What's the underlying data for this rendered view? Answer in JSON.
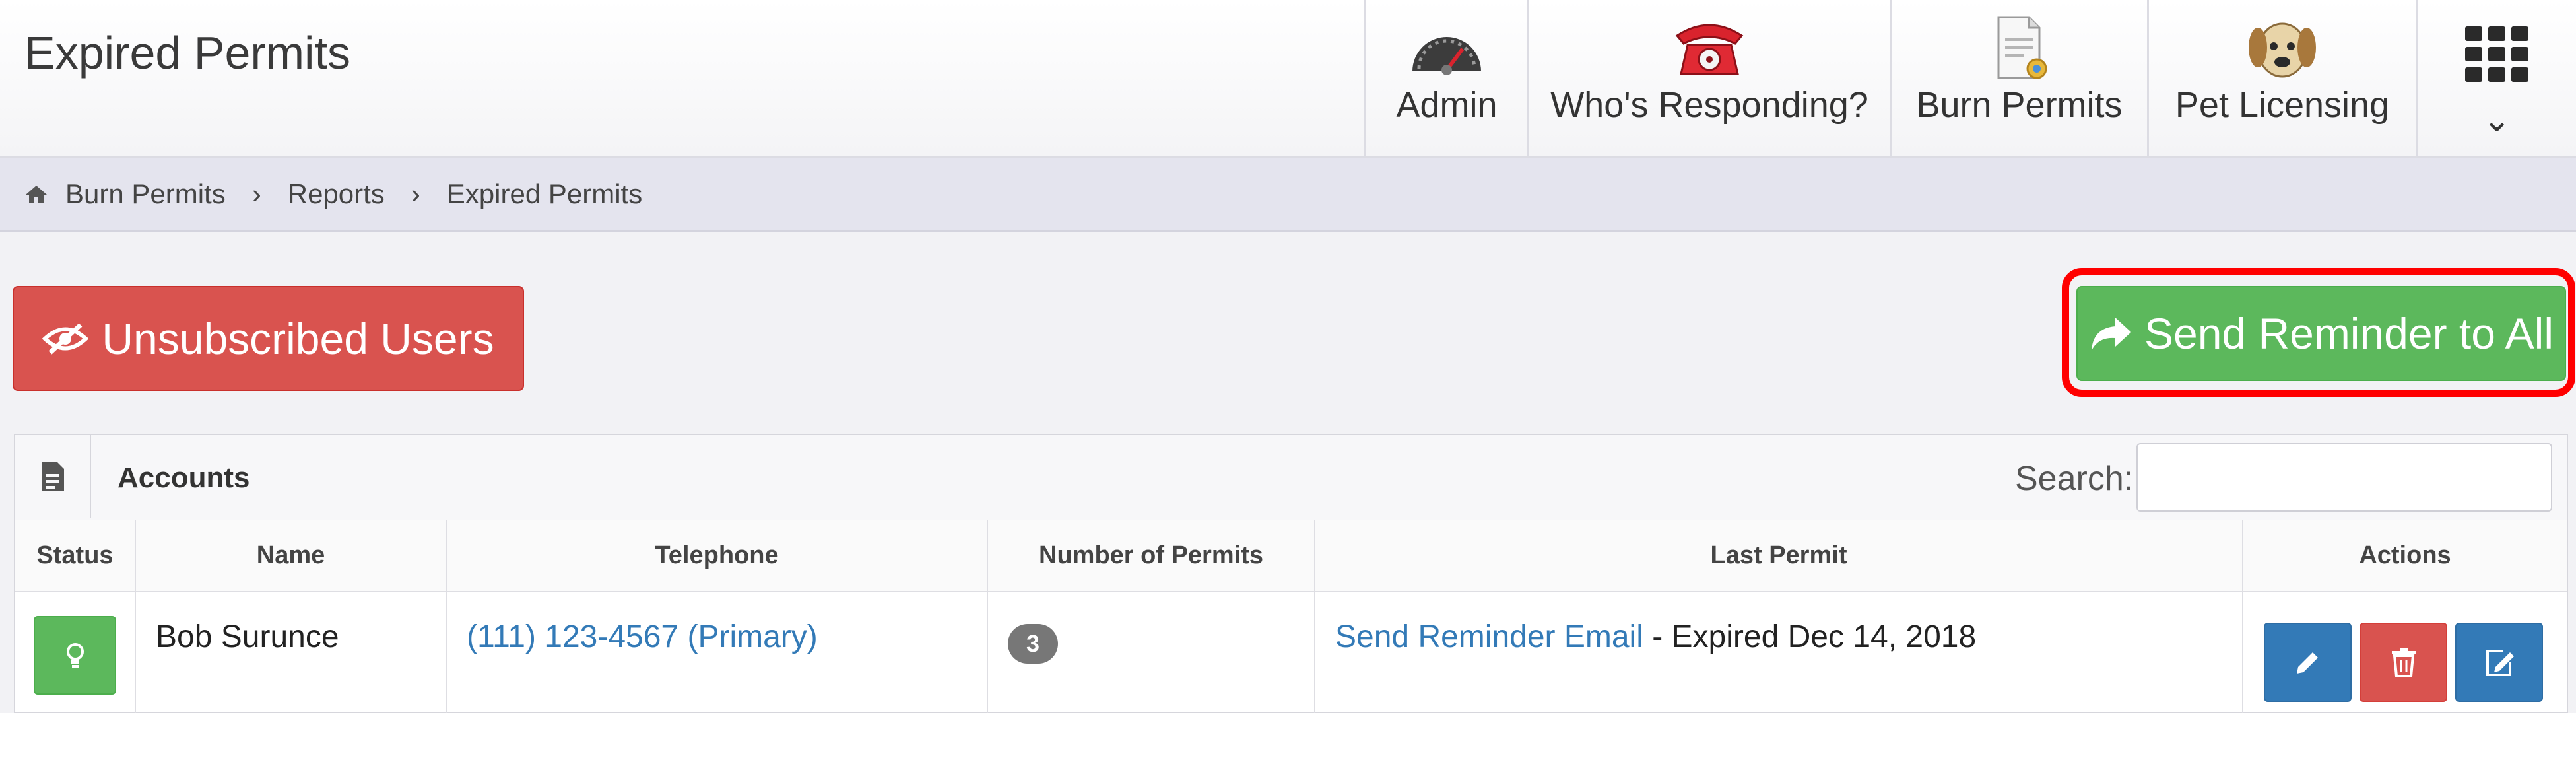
{
  "header": {
    "title": "Expired Permits",
    "nav": [
      {
        "label": "Admin",
        "icon": "speedometer-icon"
      },
      {
        "label": "Who's Responding?",
        "icon": "red-telephone-icon"
      },
      {
        "label": "Burn Permits",
        "icon": "document-certificate-icon"
      },
      {
        "label": "Pet Licensing",
        "icon": "dog-icon"
      }
    ],
    "apps_icon": "grid-apps-icon",
    "apps_chevron": "⌄"
  },
  "breadcrumb": {
    "home_icon": "home-icon",
    "items": [
      "Burn Permits",
      "Reports",
      "Expired Permits"
    ],
    "separator": "›"
  },
  "buttons": {
    "unsubscribed": "Unsubscribed Users",
    "send_all": "Send Reminder to All"
  },
  "panel": {
    "title": "Accounts",
    "search_label": "Search:",
    "search_value": ""
  },
  "table": {
    "columns": [
      "Status",
      "Name",
      "Telephone",
      "Number of Permits",
      "Last Permit",
      "Actions"
    ],
    "rows": [
      {
        "name": "Bob Surunce",
        "telephone": "(111) 123-4567 (Primary)",
        "permits": "3",
        "reminder_link": "Send Reminder Email",
        "expired_text": " - Expired Dec 14, 2018"
      }
    ]
  },
  "colors": {
    "green": "#5cb85c",
    "red": "#d9534f",
    "blue": "#337ab7",
    "highlight": "#ff0000"
  }
}
